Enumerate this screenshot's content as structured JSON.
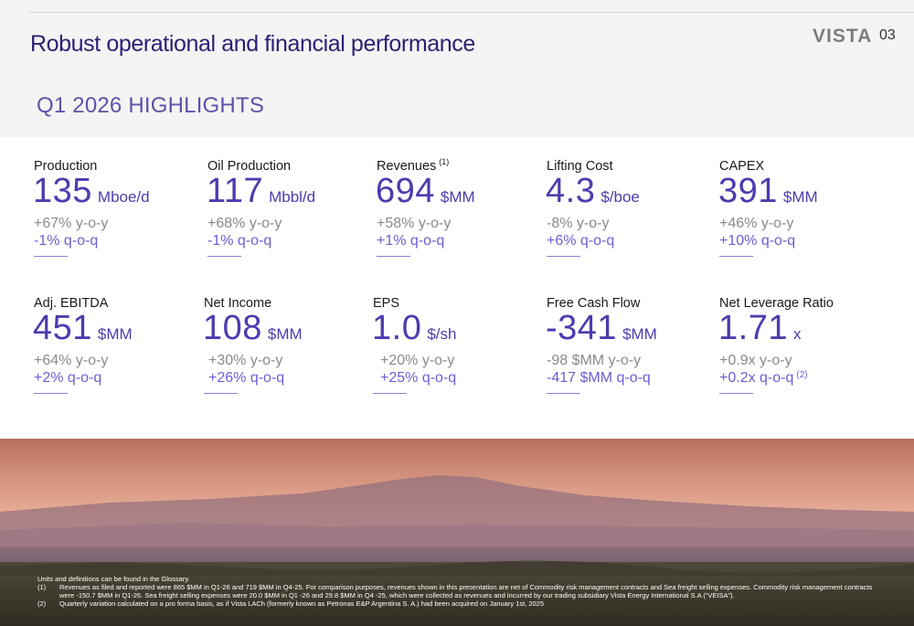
{
  "header": {
    "title": "Robust operational and financial performance",
    "brand": "VISTA",
    "page_number": "03"
  },
  "section_title": "Q1 2026 HIGHLIGHTS",
  "metrics": [
    {
      "label": "Production",
      "sup": "",
      "value": "135",
      "unit": "Mboe/d",
      "yoy": "+67% y-o-y",
      "qoq": "-1% q-o-q",
      "qoq_sup": ""
    },
    {
      "label": "Oil Production",
      "sup": "",
      "value": "117",
      "unit": "Mbbl/d",
      "yoy": "+68% y-o-y",
      "qoq": "-1% q-o-q",
      "qoq_sup": ""
    },
    {
      "label": "Revenues",
      "sup": "(1)",
      "value": "694",
      "unit": "$MM",
      "yoy": "+58% y-o-y",
      "qoq": "+1% q-o-q",
      "qoq_sup": ""
    },
    {
      "label": "Lifting Cost",
      "sup": "",
      "value": "4.3",
      "unit": "$/boe",
      "yoy": "-8% y-o-y",
      "qoq": "+6% q-o-q",
      "qoq_sup": ""
    },
    {
      "label": "CAPEX",
      "sup": "",
      "value": "391",
      "unit": "$MM",
      "yoy": "+46% y-o-y",
      "qoq": "+10% q-o-q",
      "qoq_sup": ""
    },
    {
      "label": "Adj. EBITDA",
      "sup": "",
      "value": "451",
      "unit": "$MM",
      "yoy": "+64% y-o-y",
      "qoq": "+2% q-o-q",
      "qoq_sup": ""
    },
    {
      "label": "Net Income",
      "sup": "",
      "value": "108",
      "unit": "$MM",
      "yoy": "+30% y-o-y",
      "qoq": "+26% q-o-q",
      "qoq_sup": ""
    },
    {
      "label": "EPS",
      "sup": "",
      "value": "1.0",
      "unit": "$/sh",
      "yoy": "+20% y-o-y",
      "qoq": "+25% q-o-q",
      "qoq_sup": ""
    },
    {
      "label": "Free Cash Flow",
      "sup": "",
      "value": "-341",
      "unit": "$MM",
      "yoy": "-98 $MM y-o-y",
      "qoq": "-417 $MM q-o-q",
      "qoq_sup": ""
    },
    {
      "label": "Net Leverage Ratio",
      "sup": "",
      "value": "1.71",
      "unit": "x",
      "yoy": "+0.9x y-o-y",
      "qoq": "+0.2x q-o-q",
      "qoq_sup": "(2)"
    }
  ],
  "footnotes": {
    "intro": "Units and definitions can be found in the Glossary.",
    "items": [
      {
        "num": "(1)",
        "text": "Revenues as filed and reported were 865 $MM in Q1-26 and 719 $MM in Q4-25. For comparison purposes, revenues shown in this presentation are net of Commodity risk management contracts and Sea freight selling expenses. Commodity risk management contracts were -150.7 $MM in Q1-26. Sea freight selling expenses were 20.0 $MM in Q1 -26 and 29.8 $MM in Q4 -25, which were collected as revenues and incurred by our trading subsidiary Vista Energy International S.A (“VEISA”)."
      },
      {
        "num": "(2)",
        "text": "Quarterly variation calculated on a pro forma basis, as if Vista LACh (formerly known as Petronas E&P Argentina S. A.) had been acquired on January 1st, 2025"
      }
    ]
  },
  "colors": {
    "title": "#2b1f73",
    "accent": "#4b3cae",
    "qoq": "#6a5fd0",
    "muted": "#8a8a8a"
  }
}
